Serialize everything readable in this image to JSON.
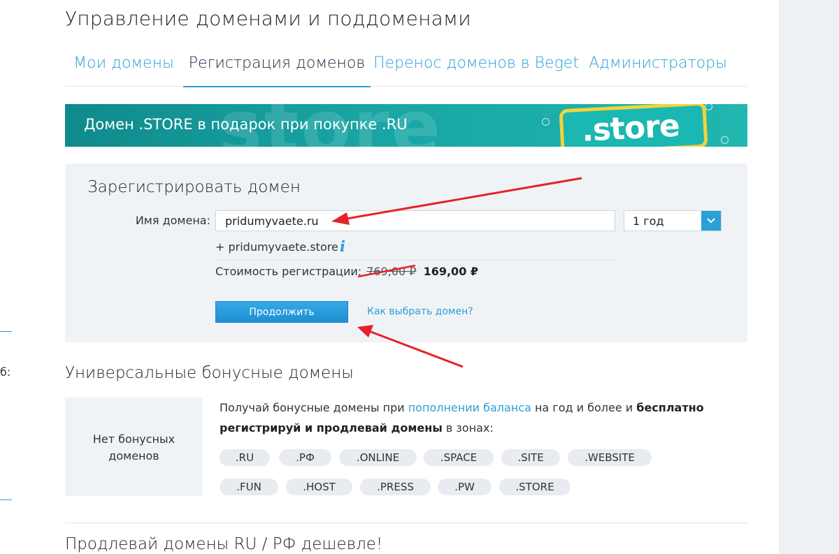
{
  "page": {
    "title": "Управление доменами и поддоменами"
  },
  "tabs": [
    {
      "label": "Мои домены"
    },
    {
      "label": "Регистрация доменов"
    },
    {
      "label": "Перенос доменов в Beget"
    },
    {
      "label": "Администраторы"
    }
  ],
  "banner": {
    "text": "Домен .STORE в подарок при покупке .RU",
    "badge": ".store",
    "watermark": "store"
  },
  "register": {
    "title": "Зарегистрировать домен",
    "domain_label": "Имя домена:",
    "domain_value": "pridumyvaete.ru",
    "period_value": "1 год",
    "bonus_domain": "+ pridumyvaete.store",
    "info_icon_glyph": "i",
    "cost_label": "Стоимость регистрации:",
    "old_price": "769,00 ₽",
    "new_price": "169,00 ₽",
    "continue_label": "Продолжить",
    "how_link": "Как выбрать домен?"
  },
  "bonus": {
    "title": "Универсальные бонусные домены",
    "no_bonus_line1": "Нет бонусных",
    "no_bonus_line2": "доменов",
    "desc_part1": "Получай бонусные домены при ",
    "desc_link": "пополнении баланса",
    "desc_part2": " на год и более и ",
    "desc_bold": "бесплатно регистрируй и продлевай домены",
    "desc_part3": " в зонах:",
    "zones_row1": [
      ".RU",
      ".РФ",
      ".ONLINE",
      ".SPACE",
      ".SITE",
      ".WEBSITE"
    ],
    "zones_row2": [
      ".FUN",
      ".HOST",
      ".PRESS",
      ".PW",
      ".STORE"
    ]
  },
  "renew": {
    "title": "Продлевай домены RU / РФ дешевле!"
  },
  "left_fragment": "б:",
  "colors": {
    "accent": "#2a9fd8",
    "panel_bg": "#f0f3f6",
    "banner_bg": "#18a5a4",
    "annotation_arrow": "#e8202a"
  }
}
